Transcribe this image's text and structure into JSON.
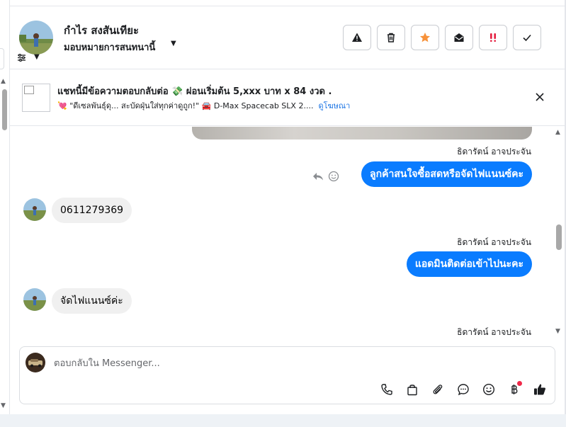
{
  "header": {
    "contact_name": "กำไร สงสันเทียะ",
    "assign_label": "มอบหมายการสนทนานี้"
  },
  "ad": {
    "title": "แชทนี้มีข้อความตอบกลับต่อ 💸 ผ่อนเริ่มต้น 5,xxx บาท x 84 งวด .",
    "subtitle": "💘 \"ดีเซลพันธุ์ดุ... สะบัดฝุ่นใส่ทุกค่าดูถูก!\" 🚘 D-Max Spacecab SLX 2....",
    "link": "ดูโฆษณา"
  },
  "thread": {
    "messages": [
      {
        "direction": "out",
        "sender": "ธิดารัตน์ อาจประจัน",
        "text": "ลูกค้าสนใจซื้อสดหรือจัดไฟแนนซ์คะ"
      },
      {
        "direction": "in",
        "text": "0611279369"
      },
      {
        "direction": "out",
        "sender": "ธิดารัตน์ อาจประจัน",
        "text": "แอดมินติดต่อเข้าไปนะคะ"
      },
      {
        "direction": "in",
        "text": "จัดไฟแนนซ์ค่ะ"
      },
      {
        "direction": "out",
        "sender": "ธิดารัตน์ อาจประจัน"
      }
    ]
  },
  "composer": {
    "placeholder": "ตอบกลับใน Messenger..."
  },
  "colors": {
    "accent": "#0a7cff",
    "star": "#f7923a",
    "alert": "#e41e3f",
    "badge": "#f02849"
  },
  "icons": {
    "header_actions": [
      "warning-icon",
      "trash-icon",
      "star-icon",
      "envelope-open-icon",
      "priority-icon",
      "check-icon"
    ],
    "composer_tools": [
      "phone-icon",
      "shopping-bag-icon",
      "paperclip-icon",
      "chat-bubble-icon",
      "smiley-icon",
      "baht-icon",
      "thumbs-up-icon"
    ]
  }
}
